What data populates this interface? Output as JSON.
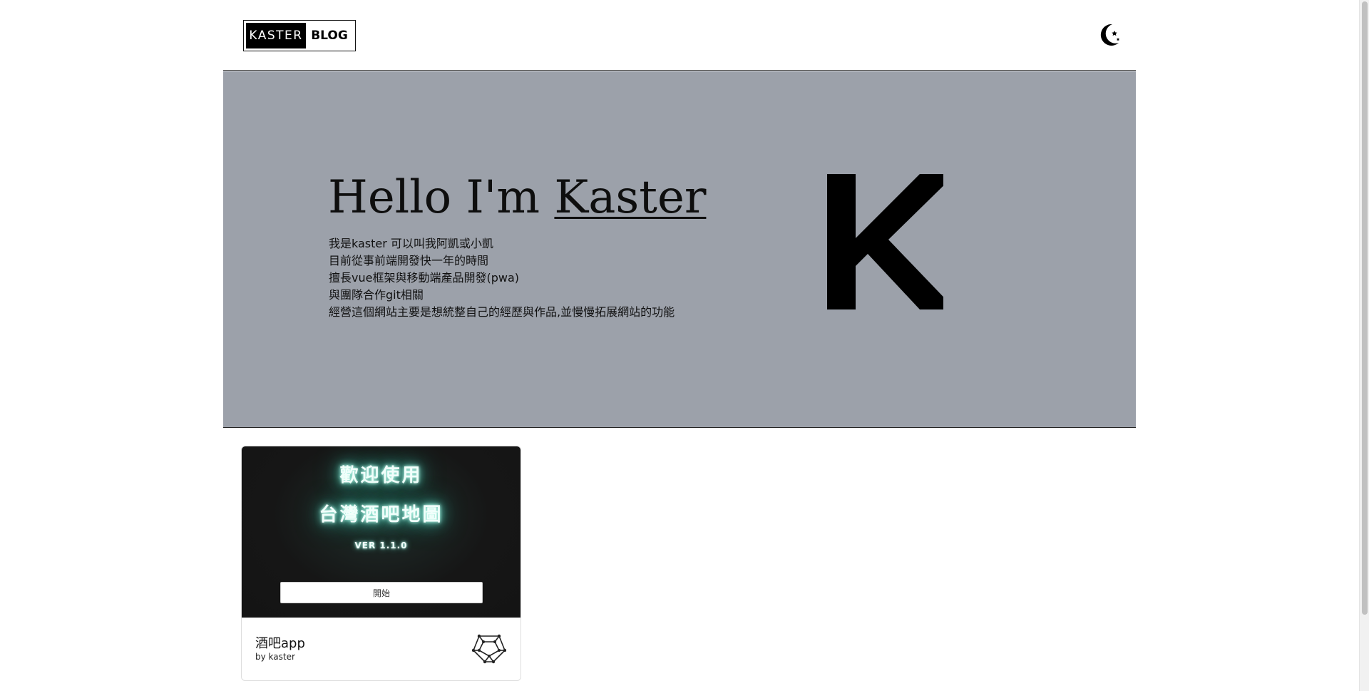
{
  "header": {
    "logo_left": "KASTER",
    "logo_right": "BLOG",
    "theme_toggle_icon": "moon-stars-icon"
  },
  "hero": {
    "greeting": "Hello I'm ",
    "name": "Kaster",
    "description": [
      "我是kaster 可以叫我阿凱或小凱",
      "目前從事前端開發快一年的時間",
      "擅長vue框架與移動端產品開發(pwa)",
      "與團隊合作git相關",
      "經營這個網站主要是想統整自己的經歷與作品,並慢慢拓展網站的功能"
    ],
    "monogram_icon": "k-monogram-icon",
    "background_color": "#9ca1aa"
  },
  "projects": [
    {
      "preview": {
        "line1": "歡迎使用",
        "line2": "台灣酒吧地圖",
        "version": "VER 1.1.0",
        "button": "開始"
      },
      "title": "酒吧app",
      "author": "by kaster",
      "icon": "network-polyhedron-icon"
    }
  ]
}
